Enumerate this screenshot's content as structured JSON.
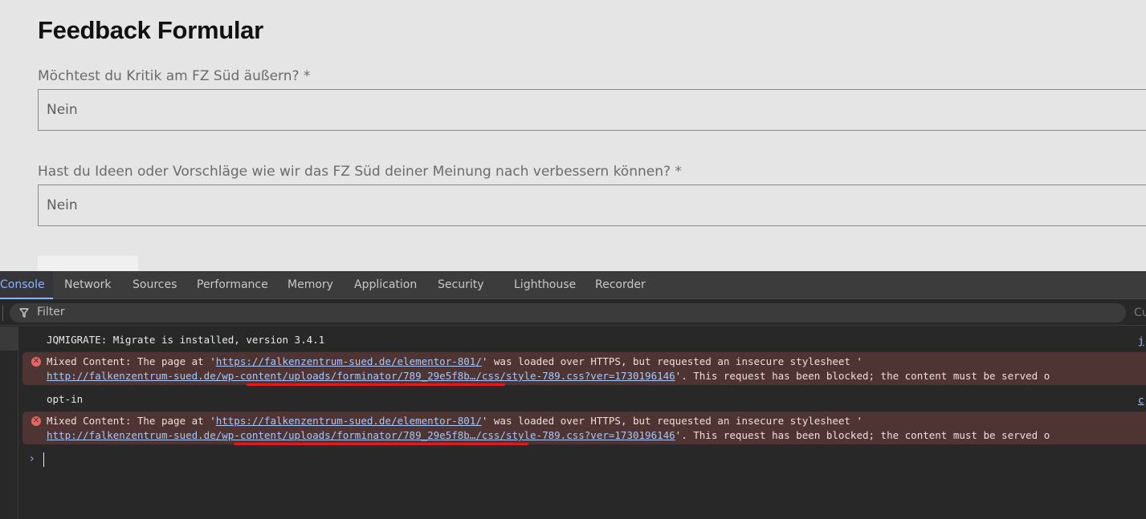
{
  "page": {
    "title": "Feedback Formular",
    "questions": [
      {
        "label": "Möchtest du Kritik am FZ Süd äußern? *",
        "value": "Nein"
      },
      {
        "label": "Hast du Ideen oder Vorschläge wie wir das FZ Süd deiner Meinung nach verbessern können? *",
        "value": "Nein"
      }
    ]
  },
  "devtools": {
    "tabs": [
      {
        "label": "Console",
        "active": true
      },
      {
        "label": "Network",
        "active": false
      },
      {
        "label": "Sources",
        "active": false
      },
      {
        "label": "Performance",
        "active": false
      },
      {
        "label": "Memory",
        "active": false
      },
      {
        "label": "Application",
        "active": false
      },
      {
        "label": "Security",
        "active": false
      },
      {
        "label": "Lighthouse",
        "active": false
      },
      {
        "label": "Recorder",
        "active": false
      }
    ],
    "filter": {
      "placeholder": "Filter",
      "right_text": "Cu"
    },
    "messages": [
      {
        "type": "log",
        "text": "JQMIGRATE: Migrate is installed, version 3.4.1",
        "source": "j"
      },
      {
        "type": "error",
        "prefix": "Mixed Content: The page at '",
        "page_url": "https://falkenzentrum-sued.de/elementor-801/",
        "middle": "' was loaded over HTTPS, but requested an insecure stylesheet '",
        "resource_url": "http://falkenzentrum-sued.de/wp-content/uploads/forminator/789_29e5f8b…/css/style-789.css?ver=1730196146",
        "suffix": "'. This request has been blocked; the content must be served o"
      },
      {
        "type": "log",
        "text": "opt-in",
        "source": "c"
      },
      {
        "type": "error",
        "prefix": "Mixed Content: The page at '",
        "page_url": "https://falkenzentrum-sued.de/elementor-801/",
        "middle": "' was loaded over HTTPS, but requested an insecure stylesheet '",
        "resource_url": "http://falkenzentrum-sued.de/wp-content/uploads/forminator/789_29e5f8b…/css/style-789.css?ver=1730196146",
        "suffix": "'. This request has been blocked; the content must be served o"
      }
    ],
    "prompt_symbol": "›",
    "colors": {
      "accent": "#8ab4f8",
      "error_bg": "#4e3534",
      "annotation": "#e31b1b"
    }
  }
}
